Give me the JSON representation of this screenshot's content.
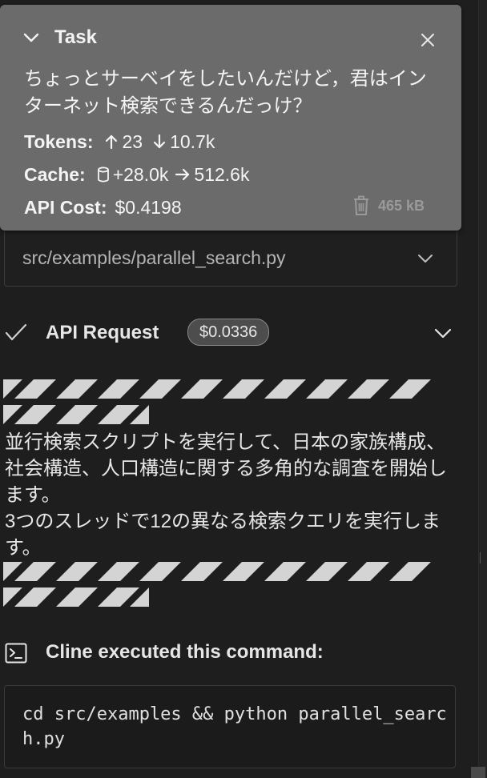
{
  "task": {
    "title": "Task",
    "message": "ちょっとサーベイをしたいんだけど，君はインターネット検索できるんだっけ？",
    "tokens_label": "Tokens:",
    "tokens_up": "23",
    "tokens_down": "10.7k",
    "cache_label": "Cache:",
    "cache_write": "+28.0k",
    "cache_read": "512.6k",
    "cost_label": "API Cost:",
    "cost_value": "$0.4198",
    "size": "465 kB"
  },
  "file_row": {
    "path": "src/examples/parallel_search.py"
  },
  "api_request": {
    "label": "API Request",
    "cost": "$0.0336"
  },
  "body": {
    "paragraph_1": "並行検索スクリプトを実行して、日本の家族構成、社会構造、人口構造に関する多角的な調査を開始します。",
    "paragraph_2": "3つのスレッドで12の異なる検索クエリを実行します。"
  },
  "command": {
    "title": "Cline executed this command:",
    "code": "cd src/examples && python parallel_search.py"
  },
  "icons": {
    "collapse": "chevron-down-icon",
    "close": "close-icon",
    "up": "arrow-up-icon",
    "down": "arrow-down-icon",
    "cache": "database-icon",
    "right": "arrow-right-icon",
    "delete": "trash-icon",
    "check": "check-icon",
    "terminal": "terminal-icon"
  },
  "colors": {
    "background": "#1e1e1e",
    "task_panel": "#6b6b6b",
    "badge": "#4d4d4d",
    "stripe": "#d4d4d4"
  }
}
